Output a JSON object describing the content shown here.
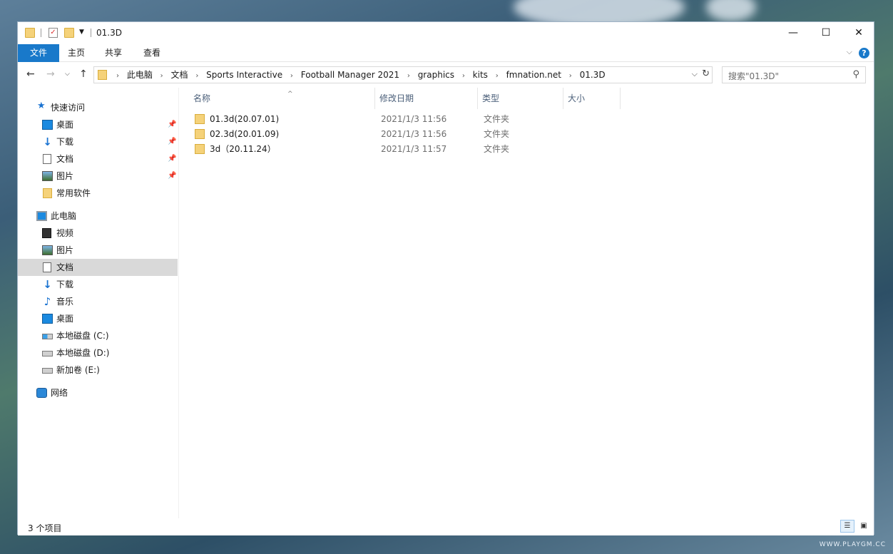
{
  "window": {
    "title": "01.3D"
  },
  "ribbon": {
    "tabs": [
      {
        "label": "文件"
      },
      {
        "label": "主页"
      },
      {
        "label": "共享"
      },
      {
        "label": "查看"
      }
    ],
    "help": "?"
  },
  "address": {
    "crumbs": [
      "此电脑",
      "文档",
      "Sports Interactive",
      "Football Manager 2021",
      "graphics",
      "kits",
      "fmnation.net",
      "01.3D"
    ]
  },
  "search": {
    "placeholder": "搜索\"01.3D\""
  },
  "sidebar": {
    "items": [
      {
        "label": "快速访问",
        "icon": "star-icon"
      },
      {
        "label": "桌面",
        "icon": "desktop-icon",
        "pinned": true
      },
      {
        "label": "下载",
        "icon": "download-icon",
        "pinned": true
      },
      {
        "label": "文档",
        "icon": "document-icon",
        "pinned": true
      },
      {
        "label": "图片",
        "icon": "pictures-icon",
        "pinned": true
      },
      {
        "label": "常用软件",
        "icon": "folder-icon"
      },
      {
        "label": "此电脑",
        "icon": "computer-icon"
      },
      {
        "label": "视频",
        "icon": "video-icon"
      },
      {
        "label": "图片",
        "icon": "pictures-icon"
      },
      {
        "label": "文档",
        "icon": "document-icon",
        "selected": true
      },
      {
        "label": "下载",
        "icon": "download-icon"
      },
      {
        "label": "音乐",
        "icon": "music-icon"
      },
      {
        "label": "桌面",
        "icon": "desktop-icon"
      },
      {
        "label": "本地磁盘 (C:)",
        "icon": "system-drive-icon"
      },
      {
        "label": "本地磁盘 (D:)",
        "icon": "drive-icon"
      },
      {
        "label": "新加卷 (E:)",
        "icon": "drive-icon"
      },
      {
        "label": "网络",
        "icon": "network-icon"
      }
    ]
  },
  "table": {
    "columns": [
      "名称",
      "修改日期",
      "类型",
      "大小"
    ],
    "rows": [
      {
        "name": "01.3d(20.07.01)",
        "date": "2021/1/3 11:56",
        "type": "文件夹"
      },
      {
        "name": "02.3d(20.01.09)",
        "date": "2021/1/3 11:56",
        "type": "文件夹"
      },
      {
        "name": "3d（20.11.24）",
        "date": "2021/1/3 11:57",
        "type": "文件夹"
      }
    ]
  },
  "status": {
    "count": "3 个项目"
  },
  "watermark": "WWW.PLAYGM.CC"
}
